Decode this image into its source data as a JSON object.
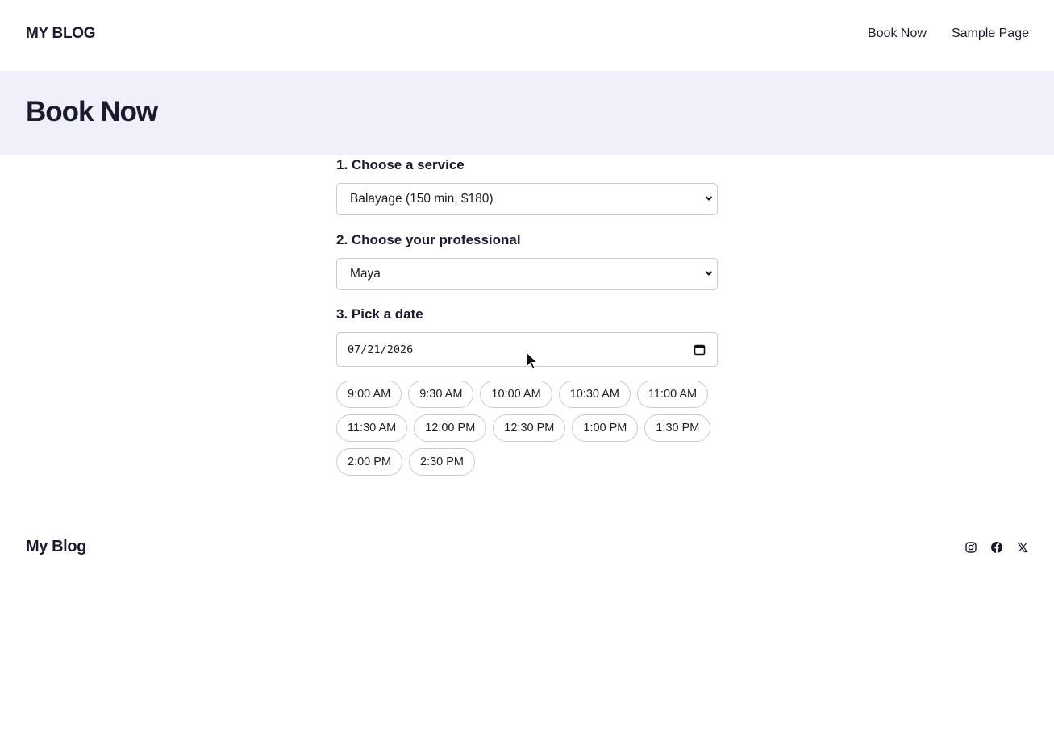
{
  "header": {
    "site_title": "MY BLOG",
    "nav": [
      {
        "label": "Book Now"
      },
      {
        "label": "Sample Page"
      }
    ]
  },
  "page": {
    "title": "Book Now"
  },
  "form": {
    "service": {
      "label": "1. Choose a service",
      "value": "Balayage (150 min, $180)"
    },
    "professional": {
      "label": "2. Choose your professional",
      "value": "Maya"
    },
    "date": {
      "label": "3. Pick a date",
      "value": "07/21/2026"
    },
    "time_slots": [
      "9:00 AM",
      "9:30 AM",
      "10:00 AM",
      "10:30 AM",
      "11:00 AM",
      "11:30 AM",
      "12:00 PM",
      "12:30 PM",
      "1:00 PM",
      "1:30 PM",
      "2:00 PM",
      "2:30 PM"
    ]
  },
  "footer": {
    "site_title": "My Blog",
    "social_icons": [
      "instagram-icon",
      "facebook-icon",
      "x-icon"
    ]
  },
  "colors": {
    "text": "#1a1b2e",
    "hero_bg": "#eff0f9",
    "border": "#c9cad1"
  }
}
